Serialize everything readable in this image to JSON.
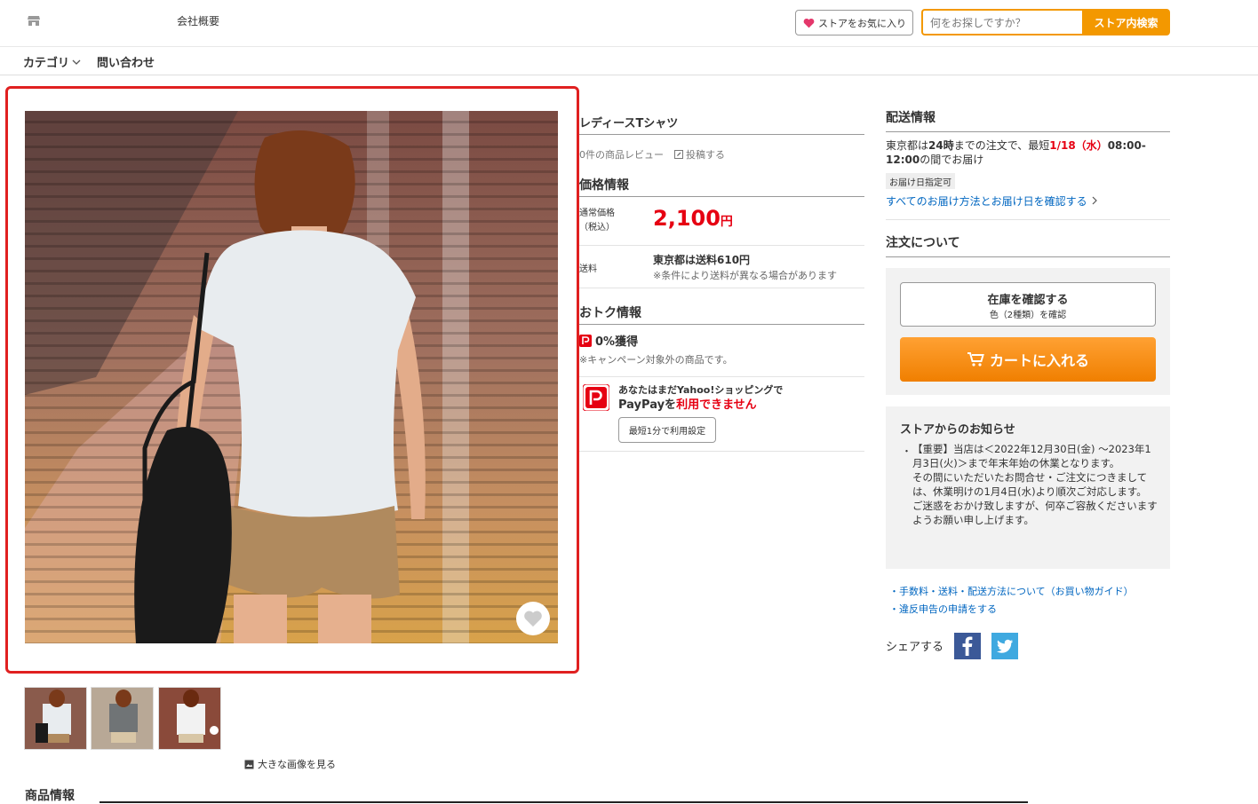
{
  "header": {
    "company_label": "会社概要",
    "favorite_store_label": "ストアをお気に入り",
    "search_placeholder": "何をお探しですか？",
    "search_button_label": "ストア内検索"
  },
  "nav": {
    "category_label": "カテゴリ",
    "contact_label": "問い合わせ"
  },
  "gallery": {
    "big_image_link": "大きな画像を見る",
    "thumbnails": [
      "thumb-1",
      "thumb-2",
      "thumb-3"
    ]
  },
  "product_info_heading": "商品情報",
  "product": {
    "title": "レディースTシャツ",
    "review_count": "0件の商品レビュー",
    "post_review": "投稿する"
  },
  "price_info": {
    "heading": "価格情報",
    "regular_label_1": "通常価格",
    "regular_label_2": "（税込）",
    "price": "2,100",
    "yen": "円",
    "shipping_label": "送料",
    "shipping_value": "東京都は送料610円",
    "shipping_note": "※条件により送料が異なる場合があります"
  },
  "deals": {
    "heading": "おトク情報",
    "points": "0%獲得",
    "points_note": "※キャンペーン対象外の商品です。",
    "paypay_line1": "あなたはまだYahoo!ショッピングで",
    "paypay_prefix": "PayPayを",
    "paypay_red": "利用できません",
    "paypay_button": "最短1分で利用設定"
  },
  "delivery": {
    "heading": "配送情報",
    "text_1": "東京都は",
    "text_2": "24時",
    "text_3": "までの注文で、最短",
    "text_4": "1/18（水）",
    "text_5": "08:00-12:00",
    "text_6": "の間でお届け",
    "tag": "お届け日指定可",
    "all_link": "すべてのお届け方法とお届け日を確認する"
  },
  "order": {
    "heading": "注文について",
    "stock_button_1": "在庫を確認する",
    "stock_button_2": "色（2種類）を確認",
    "cart_button": "カートに入れる"
  },
  "notice": {
    "title": "ストアからのお知らせ",
    "line_1": "【重要】当店は＜2022年12月30日(金) ～2023年1月3日(火)＞まで年末年始の休業となります。",
    "line_2": "その間にいただいたお問合せ・ご注文につきましては、休業明けの1月4日(水)より順次ご対応します。",
    "line_3": "ご迷惑をおかけ致しますが、何卒ご容赦くださいますようお願い申し上げます。"
  },
  "links": {
    "guide": "手数料・送料・配送方法について（お買い物ガイド）",
    "report": "違反申告の申請をする"
  },
  "share": {
    "label": "シェアする"
  },
  "colors": {
    "accent_orange": "#f39800",
    "price_red": "#e60012",
    "highlight_red": "#e02020",
    "link_blue": "#0066c0"
  }
}
